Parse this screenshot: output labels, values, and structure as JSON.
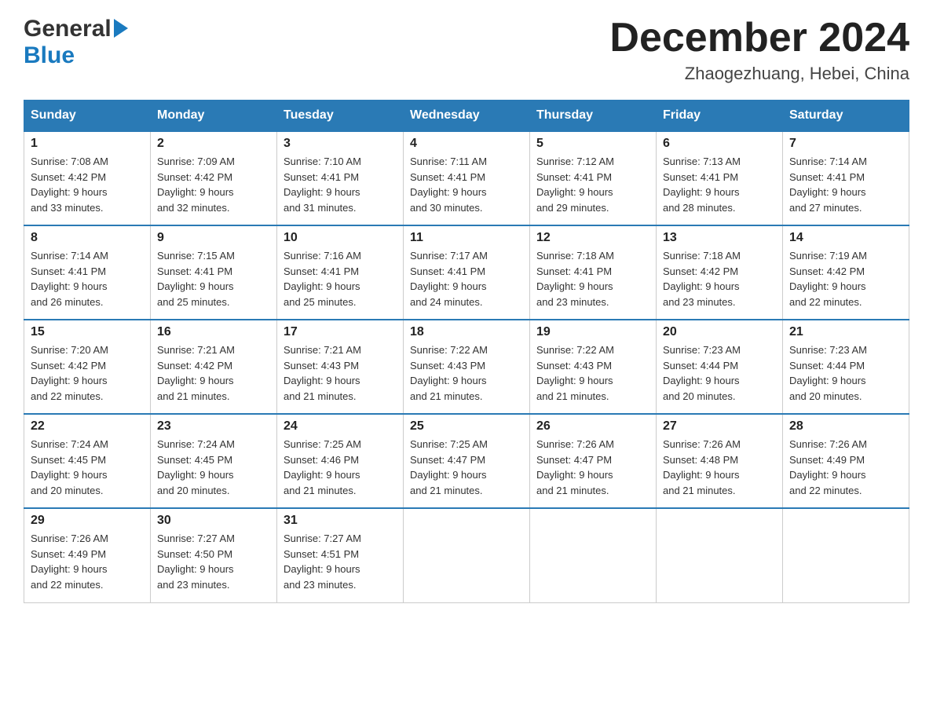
{
  "header": {
    "logo_general": "General",
    "logo_blue": "Blue",
    "month_title": "December 2024",
    "location": "Zhaogezhuang, Hebei, China"
  },
  "days_of_week": [
    "Sunday",
    "Monday",
    "Tuesday",
    "Wednesday",
    "Thursday",
    "Friday",
    "Saturday"
  ],
  "weeks": [
    [
      {
        "day": "1",
        "sunrise": "7:08 AM",
        "sunset": "4:42 PM",
        "daylight": "9 hours and 33 minutes."
      },
      {
        "day": "2",
        "sunrise": "7:09 AM",
        "sunset": "4:42 PM",
        "daylight": "9 hours and 32 minutes."
      },
      {
        "day": "3",
        "sunrise": "7:10 AM",
        "sunset": "4:41 PM",
        "daylight": "9 hours and 31 minutes."
      },
      {
        "day": "4",
        "sunrise": "7:11 AM",
        "sunset": "4:41 PM",
        "daylight": "9 hours and 30 minutes."
      },
      {
        "day": "5",
        "sunrise": "7:12 AM",
        "sunset": "4:41 PM",
        "daylight": "9 hours and 29 minutes."
      },
      {
        "day": "6",
        "sunrise": "7:13 AM",
        "sunset": "4:41 PM",
        "daylight": "9 hours and 28 minutes."
      },
      {
        "day": "7",
        "sunrise": "7:14 AM",
        "sunset": "4:41 PM",
        "daylight": "9 hours and 27 minutes."
      }
    ],
    [
      {
        "day": "8",
        "sunrise": "7:14 AM",
        "sunset": "4:41 PM",
        "daylight": "9 hours and 26 minutes."
      },
      {
        "day": "9",
        "sunrise": "7:15 AM",
        "sunset": "4:41 PM",
        "daylight": "9 hours and 25 minutes."
      },
      {
        "day": "10",
        "sunrise": "7:16 AM",
        "sunset": "4:41 PM",
        "daylight": "9 hours and 25 minutes."
      },
      {
        "day": "11",
        "sunrise": "7:17 AM",
        "sunset": "4:41 PM",
        "daylight": "9 hours and 24 minutes."
      },
      {
        "day": "12",
        "sunrise": "7:18 AM",
        "sunset": "4:41 PM",
        "daylight": "9 hours and 23 minutes."
      },
      {
        "day": "13",
        "sunrise": "7:18 AM",
        "sunset": "4:42 PM",
        "daylight": "9 hours and 23 minutes."
      },
      {
        "day": "14",
        "sunrise": "7:19 AM",
        "sunset": "4:42 PM",
        "daylight": "9 hours and 22 minutes."
      }
    ],
    [
      {
        "day": "15",
        "sunrise": "7:20 AM",
        "sunset": "4:42 PM",
        "daylight": "9 hours and 22 minutes."
      },
      {
        "day": "16",
        "sunrise": "7:21 AM",
        "sunset": "4:42 PM",
        "daylight": "9 hours and 21 minutes."
      },
      {
        "day": "17",
        "sunrise": "7:21 AM",
        "sunset": "4:43 PM",
        "daylight": "9 hours and 21 minutes."
      },
      {
        "day": "18",
        "sunrise": "7:22 AM",
        "sunset": "4:43 PM",
        "daylight": "9 hours and 21 minutes."
      },
      {
        "day": "19",
        "sunrise": "7:22 AM",
        "sunset": "4:43 PM",
        "daylight": "9 hours and 21 minutes."
      },
      {
        "day": "20",
        "sunrise": "7:23 AM",
        "sunset": "4:44 PM",
        "daylight": "9 hours and 20 minutes."
      },
      {
        "day": "21",
        "sunrise": "7:23 AM",
        "sunset": "4:44 PM",
        "daylight": "9 hours and 20 minutes."
      }
    ],
    [
      {
        "day": "22",
        "sunrise": "7:24 AM",
        "sunset": "4:45 PM",
        "daylight": "9 hours and 20 minutes."
      },
      {
        "day": "23",
        "sunrise": "7:24 AM",
        "sunset": "4:45 PM",
        "daylight": "9 hours and 20 minutes."
      },
      {
        "day": "24",
        "sunrise": "7:25 AM",
        "sunset": "4:46 PM",
        "daylight": "9 hours and 21 minutes."
      },
      {
        "day": "25",
        "sunrise": "7:25 AM",
        "sunset": "4:47 PM",
        "daylight": "9 hours and 21 minutes."
      },
      {
        "day": "26",
        "sunrise": "7:26 AM",
        "sunset": "4:47 PM",
        "daylight": "9 hours and 21 minutes."
      },
      {
        "day": "27",
        "sunrise": "7:26 AM",
        "sunset": "4:48 PM",
        "daylight": "9 hours and 21 minutes."
      },
      {
        "day": "28",
        "sunrise": "7:26 AM",
        "sunset": "4:49 PM",
        "daylight": "9 hours and 22 minutes."
      }
    ],
    [
      {
        "day": "29",
        "sunrise": "7:26 AM",
        "sunset": "4:49 PM",
        "daylight": "9 hours and 22 minutes."
      },
      {
        "day": "30",
        "sunrise": "7:27 AM",
        "sunset": "4:50 PM",
        "daylight": "9 hours and 23 minutes."
      },
      {
        "day": "31",
        "sunrise": "7:27 AM",
        "sunset": "4:51 PM",
        "daylight": "9 hours and 23 minutes."
      },
      null,
      null,
      null,
      null
    ]
  ],
  "labels": {
    "sunrise": "Sunrise:",
    "sunset": "Sunset:",
    "daylight": "Daylight:"
  }
}
